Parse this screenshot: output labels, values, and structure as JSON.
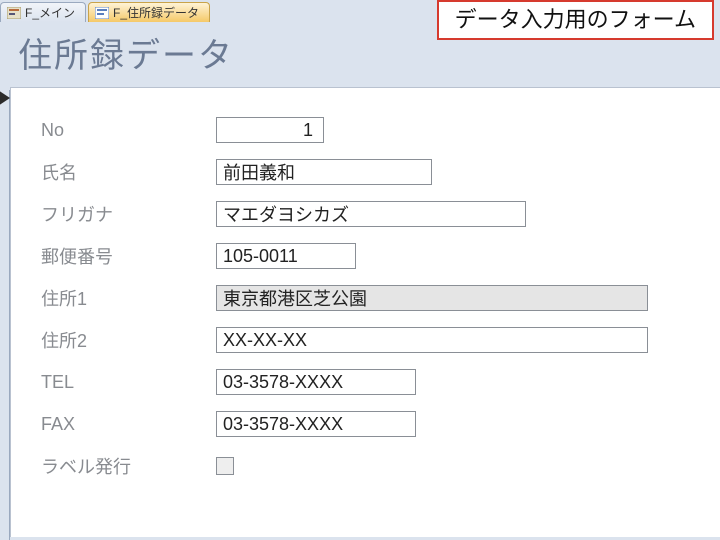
{
  "tabs": {
    "inactive": {
      "label": "F_メイン"
    },
    "active": {
      "label": "F_住所録データ"
    }
  },
  "annotation": "データ入力用のフォーム",
  "title": "住所録データ",
  "fields": {
    "no": {
      "label": "No",
      "value": "1"
    },
    "name": {
      "label": "氏名",
      "value": "前田義和"
    },
    "furigana": {
      "label": "フリガナ",
      "value": "マエダヨシカズ"
    },
    "postal": {
      "label": "郵便番号",
      "value": "105-0011"
    },
    "addr1": {
      "label": "住所1",
      "value": "東京都港区芝公園"
    },
    "addr2": {
      "label": "住所2",
      "value": "XX-XX-XX"
    },
    "tel": {
      "label": "TEL",
      "value": "03-3578-XXXX"
    },
    "fax": {
      "label": "FAX",
      "value": "03-3578-XXXX"
    },
    "label_issue": {
      "label": "ラベル発行"
    }
  }
}
